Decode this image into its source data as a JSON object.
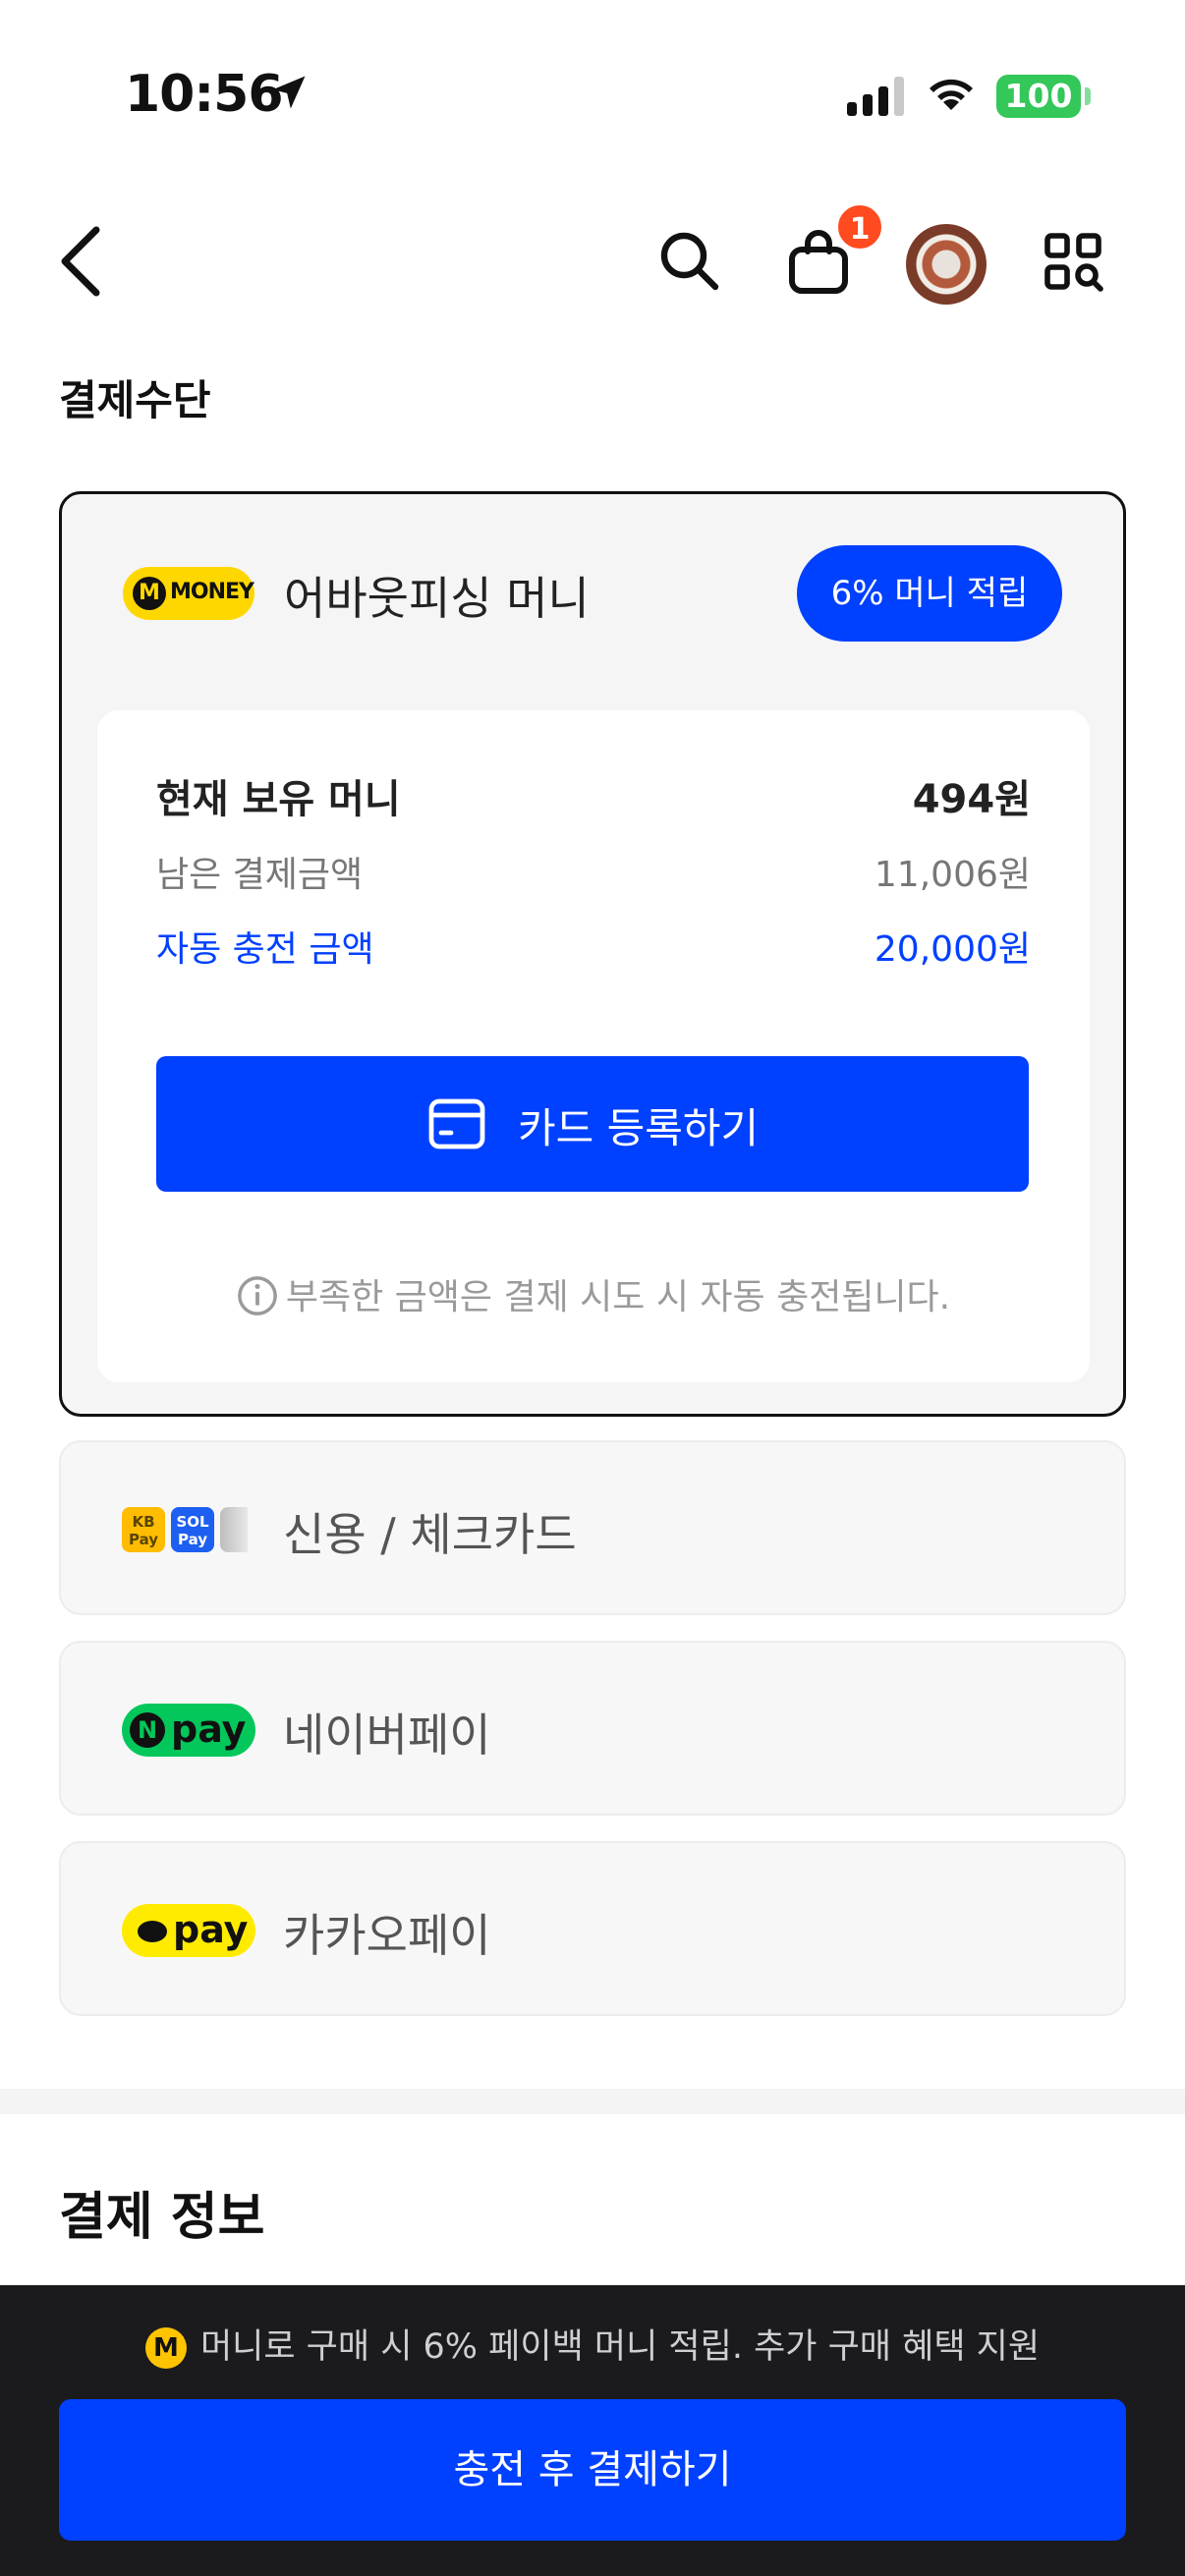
{
  "status_bar": {
    "time": "10:56",
    "battery": "100"
  },
  "header": {
    "cart_count": "1"
  },
  "payment": {
    "section_title": "결제수단",
    "money": {
      "logo_text": "MONEY",
      "logo_m": "M",
      "title": "어바웃피싱 머니",
      "badge": "6% 머니 적립",
      "rows": [
        {
          "label": "현재 보유 머니",
          "value": "494원"
        },
        {
          "label": "남은 결제금액",
          "value": "11,006원"
        },
        {
          "label": "자동 충전 금액",
          "value": "20,000원"
        }
      ],
      "register_card_button": "카드 등록하기",
      "notice": "부족한 금액은 결제 시도 시 자동 충전됩니다."
    },
    "options": [
      {
        "label": "신용 / 체크카드",
        "logo": "card-logos"
      },
      {
        "label": "네이버페이",
        "logo": "npay"
      },
      {
        "label": "카카오페이",
        "logo": "kakaopay"
      }
    ],
    "logos": {
      "kb": "KB Pay",
      "sol": "SOL Pay",
      "npay_n": "N",
      "pay": "pay"
    }
  },
  "info_title": "결제 정보",
  "bottom": {
    "promo_m": "M",
    "promo_text": "머니로 구매 시 6% 페이백 머니 적립. 추가 구매 혜택 지원",
    "pay_button": "충전 후 결제하기"
  },
  "colors": {
    "accent": "#0040ff",
    "money_yellow": "#ffd700",
    "naver_green": "#03c75a",
    "kakao_yellow": "#ffeb00",
    "badge_red": "#ff4b1f"
  }
}
